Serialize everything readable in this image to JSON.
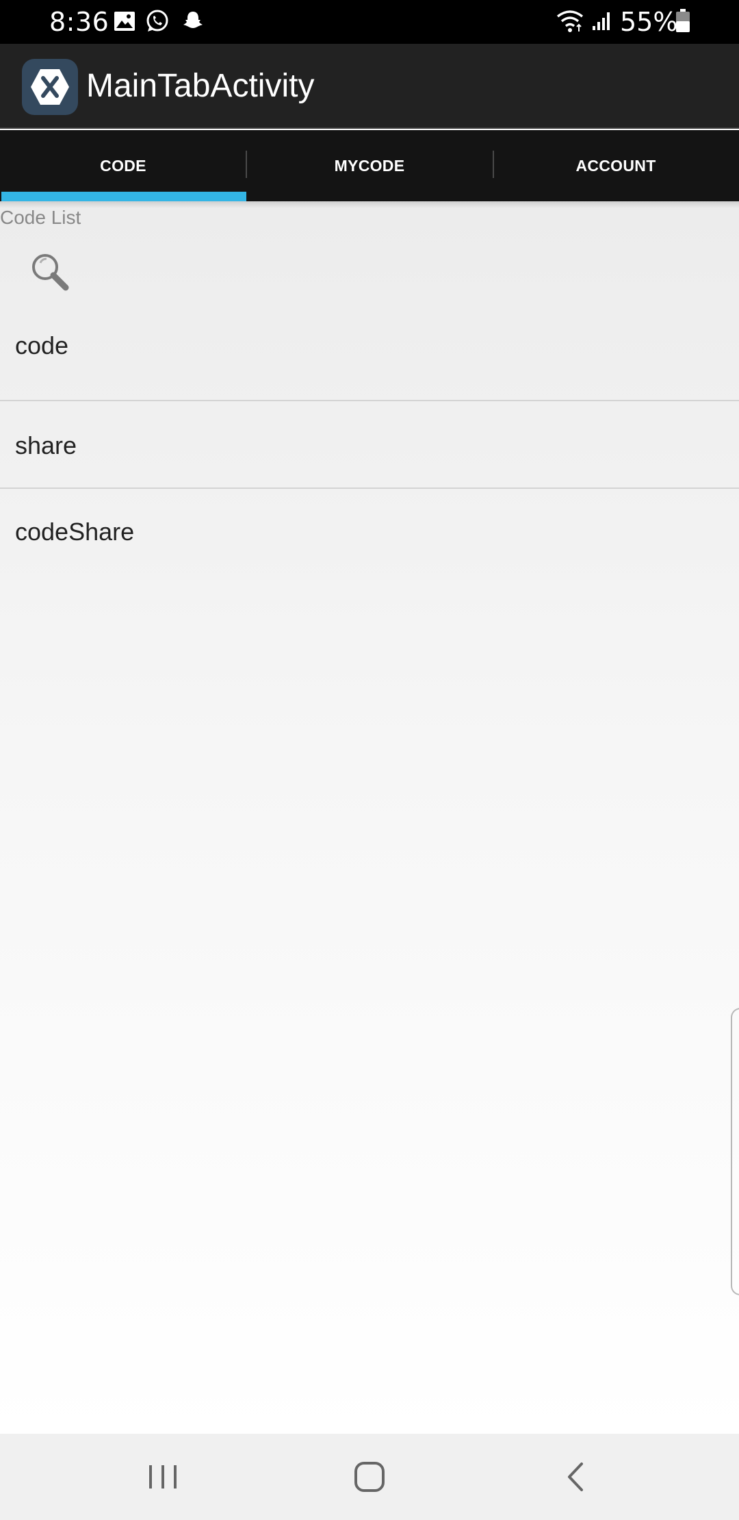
{
  "status_bar": {
    "time": "8:36",
    "battery_percent": "55%",
    "notification_icons": [
      "gallery-icon",
      "whatsapp-icon",
      "snapchat-icon"
    ],
    "system_icons": [
      "wifi-icon",
      "signal-icon",
      "battery-icon"
    ]
  },
  "action_bar": {
    "title": "MainTabActivity",
    "logo_icon": "xamarin-logo-icon"
  },
  "tabs": [
    {
      "label": "CODE",
      "selected": true
    },
    {
      "label": "MYCODE",
      "selected": false
    },
    {
      "label": "ACCOUNT",
      "selected": false
    }
  ],
  "list": {
    "header": "Code List",
    "search_icon": "search-icon",
    "items": [
      {
        "label": "code"
      },
      {
        "label": "share"
      },
      {
        "label": "codeShare"
      }
    ]
  },
  "nav_bar": {
    "buttons": [
      "recents-icon",
      "home-icon",
      "back-icon"
    ]
  },
  "colors": {
    "accent": "#33b5e5",
    "action_bar": "#222222",
    "tab_bar": "#141414",
    "status_bar": "#000000"
  }
}
